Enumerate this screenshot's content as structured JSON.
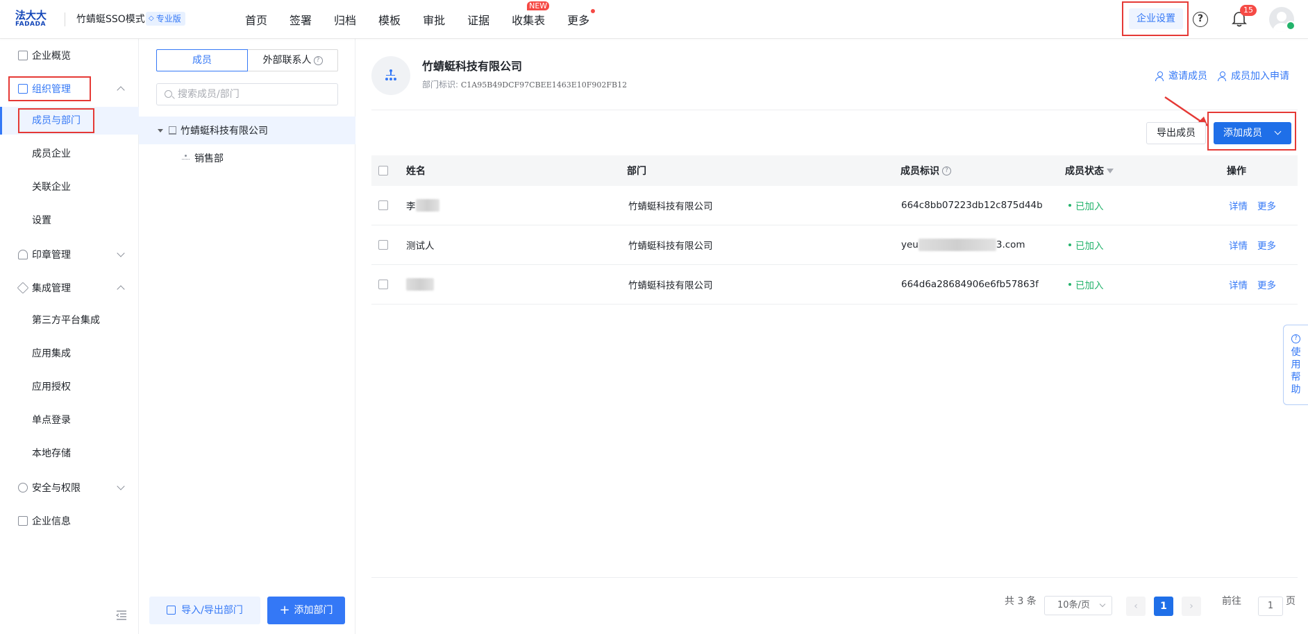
{
  "topbar": {
    "logo_main": "法大大",
    "logo_sub": "FADADA",
    "org_name": "竹蜻蜓SSO模式",
    "edition_badge": "专业版",
    "nav": [
      {
        "label": "首页"
      },
      {
        "label": "签署"
      },
      {
        "label": "归档"
      },
      {
        "label": "模板"
      },
      {
        "label": "审批"
      },
      {
        "label": "证据"
      },
      {
        "label": "收集表",
        "badge": "NEW"
      },
      {
        "label": "更多",
        "dot": true
      }
    ],
    "enterprise_settings": "企业设置",
    "notification_count": "15"
  },
  "sidebar": {
    "items": [
      {
        "label": "企业概览",
        "icon": "dashboard-icon"
      },
      {
        "label": "组织管理",
        "icon": "org-icon",
        "expanded": true
      },
      {
        "label": "成员与部门",
        "active": true
      },
      {
        "label": "成员企业"
      },
      {
        "label": "关联企业"
      },
      {
        "label": "设置"
      },
      {
        "label": "印章管理",
        "icon": "seal-icon"
      },
      {
        "label": "集成管理",
        "icon": "layers-icon",
        "expanded": true
      },
      {
        "label": "第三方平台集成"
      },
      {
        "label": "应用集成"
      },
      {
        "label": "应用授权"
      },
      {
        "label": "单点登录"
      },
      {
        "label": "本地存储"
      },
      {
        "label": "安全与权限",
        "icon": "security-icon"
      },
      {
        "label": "企业信息",
        "icon": "building-icon"
      }
    ]
  },
  "middle": {
    "tab_members": "成员",
    "tab_external": "外部联系人",
    "search_placeholder": "搜索成员/部门",
    "tree_root": "竹蜻蜓科技有限公司",
    "tree_child": "销售部",
    "import_export_btn": "导入/导出部门",
    "add_dept_btn": "添加部门"
  },
  "main": {
    "dept_title": "竹蜻蜓科技有限公司",
    "dept_id_label": "部门标识:",
    "dept_id_value": "C1A95B49DCF97CBEE1463E10F902FB12",
    "invite_link": "邀请成员",
    "join_request_link": "成员加入申请",
    "export_btn": "导出成员",
    "add_member_btn": "添加成员",
    "columns": [
      "姓名",
      "部门",
      "成员标识",
      "成员状态",
      "操作"
    ],
    "rows": [
      {
        "name": "李",
        "dept": "竹蜻蜓科技有限公司",
        "member_id": "664c8bb07223db12c875d44b",
        "status": "已加入",
        "op_detail": "详情",
        "op_more": "更多"
      },
      {
        "name": "测试人",
        "dept": "竹蜻蜓科技有限公司",
        "member_id_prefix": "yeu",
        "member_id_suffix": "3.com",
        "status": "已加入",
        "op_detail": "详情",
        "op_more": "更多"
      },
      {
        "name": "",
        "dept": "竹蜻蜓科技有限公司",
        "member_id": "664d6a28684906e6fb57863f",
        "status": "已加入",
        "op_detail": "详情",
        "op_more": "更多"
      }
    ],
    "pagination": {
      "total": "共 3 条",
      "page_size": "10条/页",
      "current": "1",
      "goto_label": "前往",
      "goto_value": "1",
      "page_unit": "页"
    }
  },
  "help_tab": {
    "label": "使用帮助"
  },
  "colors": {
    "primary": "#3478f6",
    "primary_dark": "#1f6fe8",
    "highlight": "#e53935",
    "success": "#23b36b",
    "danger": "#f54a45"
  }
}
